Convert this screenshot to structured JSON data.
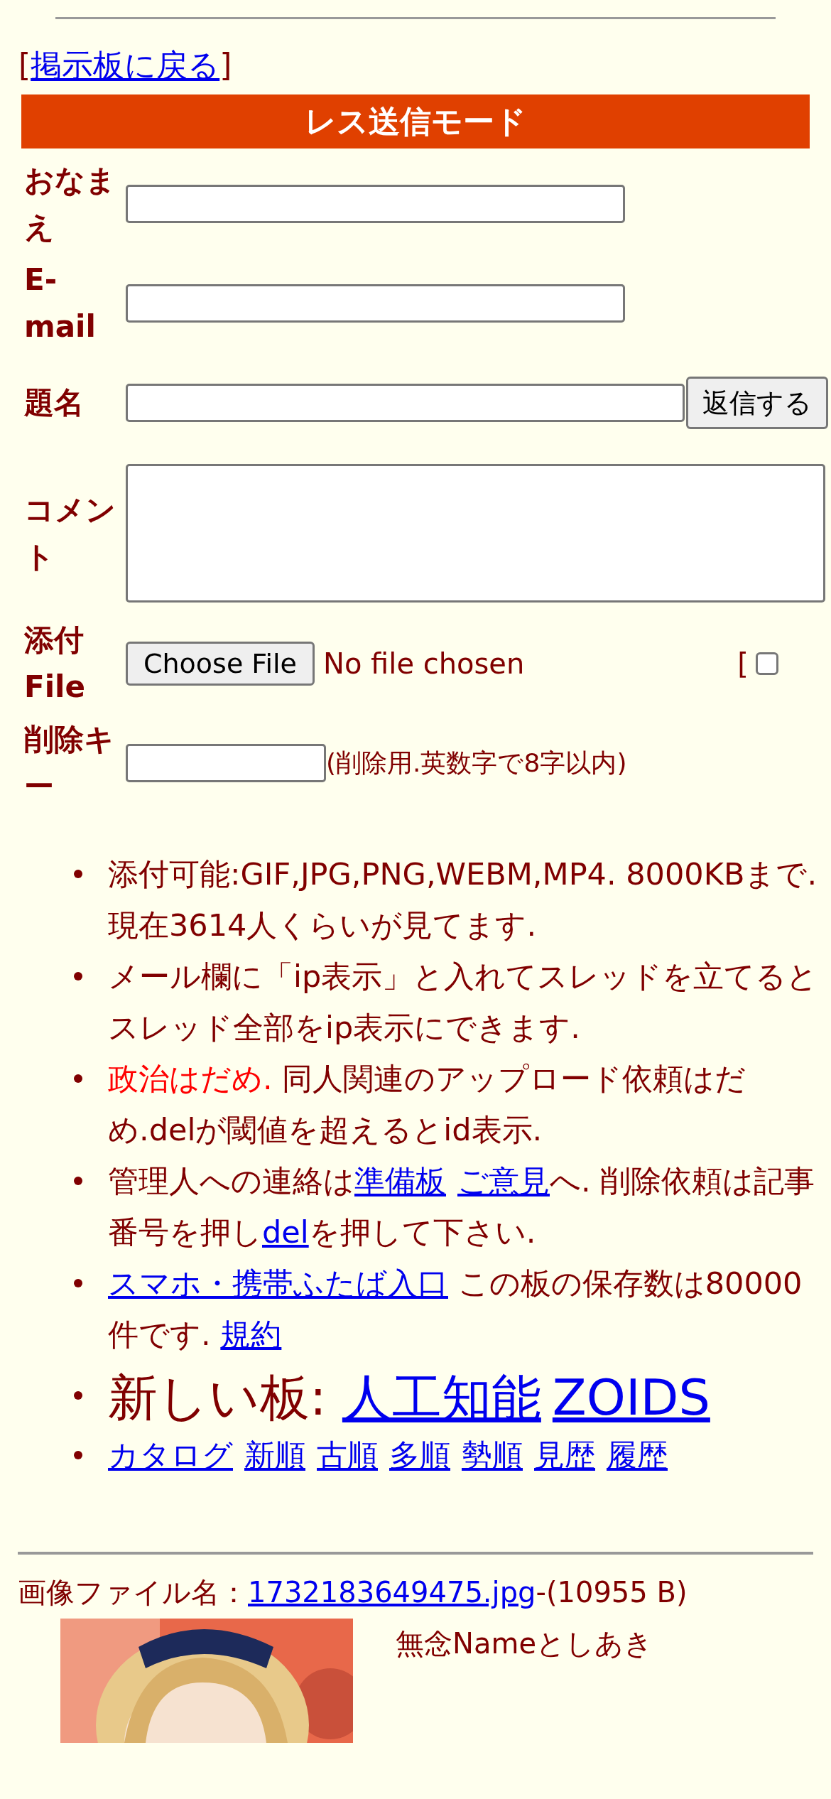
{
  "back_link": {
    "open": "[",
    "label": "掲示板に戻る",
    "close": "]"
  },
  "form": {
    "title": "レス送信モード",
    "rows": [
      {
        "kind": "text",
        "label": "おなまえ"
      },
      {
        "kind": "text",
        "label": "E-mail"
      },
      {
        "kind": "subject",
        "label": "題名",
        "button": "返信する"
      },
      {
        "kind": "textarea",
        "label": "コメント"
      },
      {
        "kind": "file",
        "label": "添付File",
        "button": "Choose File",
        "status": "No file chosen",
        "extra": "[",
        "checked": false
      },
      {
        "kind": "password",
        "label": "削除キー",
        "hint": "(削除用.英数字で8字以内)"
      }
    ]
  },
  "notices": [
    {
      "large": false,
      "parts": [
        {
          "kind": "text",
          "text": "添付可能:GIF,JPG,PNG,WEBM,MP4. 8000KBまで. 現在3614人くらいが見てます."
        }
      ]
    },
    {
      "large": false,
      "parts": [
        {
          "kind": "text",
          "text": "メール欄に「ip表示」と入れてスレッドを立てるとスレッド全部をip表示にできます."
        }
      ]
    },
    {
      "large": false,
      "parts": [
        {
          "kind": "red",
          "text": "政治はだめ."
        },
        {
          "kind": "text",
          "text": " 同人関連のアップロード依頼はだめ.delが閾値を超えるとid表示."
        }
      ]
    },
    {
      "large": false,
      "parts": [
        {
          "kind": "text",
          "text": "管理人への連絡は"
        },
        {
          "kind": "link",
          "text": "準備板"
        },
        {
          "kind": "space"
        },
        {
          "kind": "link",
          "text": "ご意見"
        },
        {
          "kind": "text",
          "text": "へ. 削除依頼は記事番号を押し"
        },
        {
          "kind": "link",
          "text": "del"
        },
        {
          "kind": "text",
          "text": "を押して下さい."
        }
      ]
    },
    {
      "large": false,
      "parts": [
        {
          "kind": "link",
          "text": "スマホ・携帯ふたば入口"
        },
        {
          "kind": "text",
          "text": " この板の保存数は80000件です. "
        },
        {
          "kind": "link",
          "text": "規約"
        }
      ]
    },
    {
      "large": true,
      "parts": [
        {
          "kind": "text",
          "text": "新しい板: "
        },
        {
          "kind": "link",
          "text": "人工知能"
        },
        {
          "kind": "space"
        },
        {
          "kind": "link",
          "text": "ZOIDS"
        }
      ]
    },
    {
      "large": false,
      "parts": [
        {
          "kind": "link",
          "text": "カタログ"
        },
        {
          "kind": "link",
          "text": "新順"
        },
        {
          "kind": "link",
          "text": "古順"
        },
        {
          "kind": "link",
          "text": "多順"
        },
        {
          "kind": "link",
          "text": "勢順"
        },
        {
          "kind": "link",
          "text": "見歴"
        },
        {
          "kind": "link",
          "text": "履歴"
        }
      ]
    }
  ],
  "post": {
    "file_label": "画像ファイル名：",
    "file_name": "1732183649475.jpg",
    "file_size": "-(10955 B)",
    "name_line": "無念Nameとしあき"
  }
}
